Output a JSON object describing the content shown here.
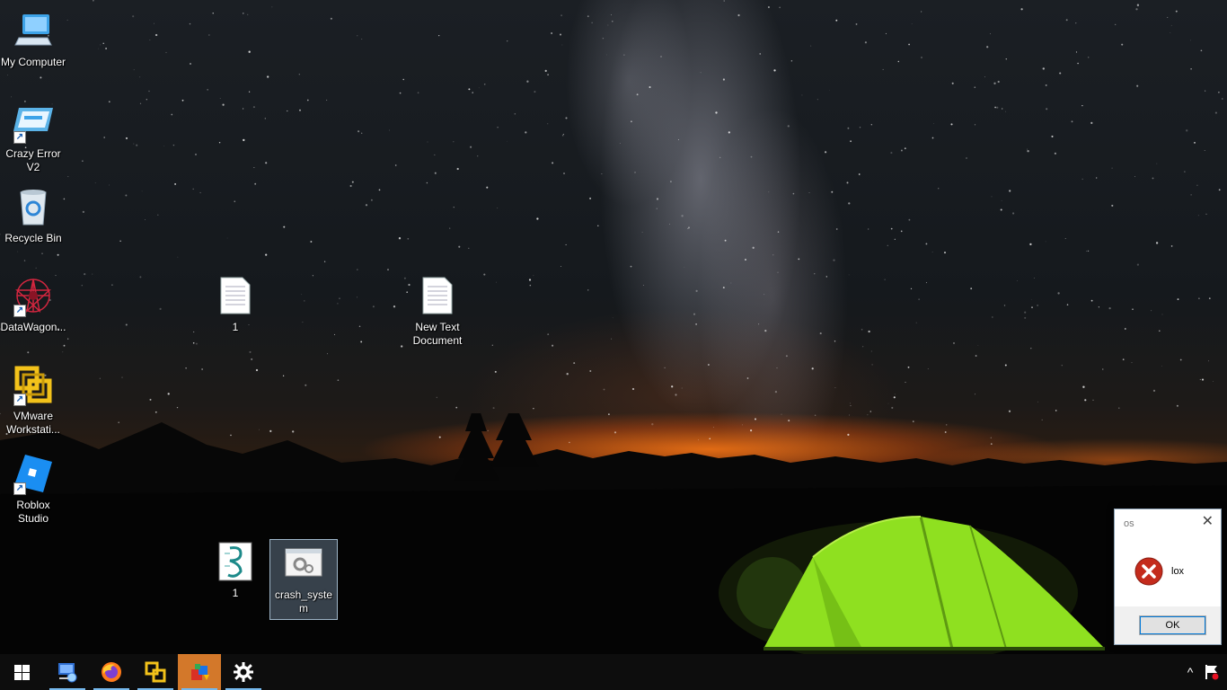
{
  "desktop": {
    "icons": [
      {
        "label": "My Computer",
        "icon": "computer-icon"
      },
      {
        "label": "Crazy Error V2",
        "icon": "crazy-error-icon"
      },
      {
        "label": "Recycle Bin",
        "icon": "recycle-bin-icon"
      },
      {
        "label": "DataWagon...",
        "icon": "datawagon-icon"
      },
      {
        "label": "VMware Workstati...",
        "icon": "vmware-icon"
      },
      {
        "label": "Roblox Studio",
        "icon": "roblox-studio-icon"
      },
      {
        "label": "1",
        "icon": "text-file-icon"
      },
      {
        "label": "New Text Document",
        "icon": "text-file-icon"
      },
      {
        "label": "1",
        "icon": "script-file-icon"
      },
      {
        "label": "crash_system",
        "icon": "exe-file-icon"
      }
    ]
  },
  "dialog": {
    "title": "os",
    "close": "✕",
    "message": "lox",
    "ok_label": "OK",
    "icon": "error-icon"
  },
  "taskbar": {
    "start_icon": "windows-start-icon",
    "apps": [
      {
        "name": "network-computer-icon",
        "pinned": true,
        "running": true
      },
      {
        "name": "firefox-icon",
        "running": true
      },
      {
        "name": "vmware-icon",
        "running": true
      },
      {
        "name": "installer-icon",
        "running": true,
        "active": true
      },
      {
        "name": "settings-gear-icon",
        "running": true
      }
    ],
    "tray": {
      "chevron": "^",
      "flag_icon": "action-center-flag-icon"
    }
  },
  "colors": {
    "taskbar_bg": "#0d0d0d",
    "active_app": "#d3782a",
    "running_underline": "#76b9ed",
    "tent_green": "#8fe020",
    "sunset_orange": "#ff7a1a"
  }
}
